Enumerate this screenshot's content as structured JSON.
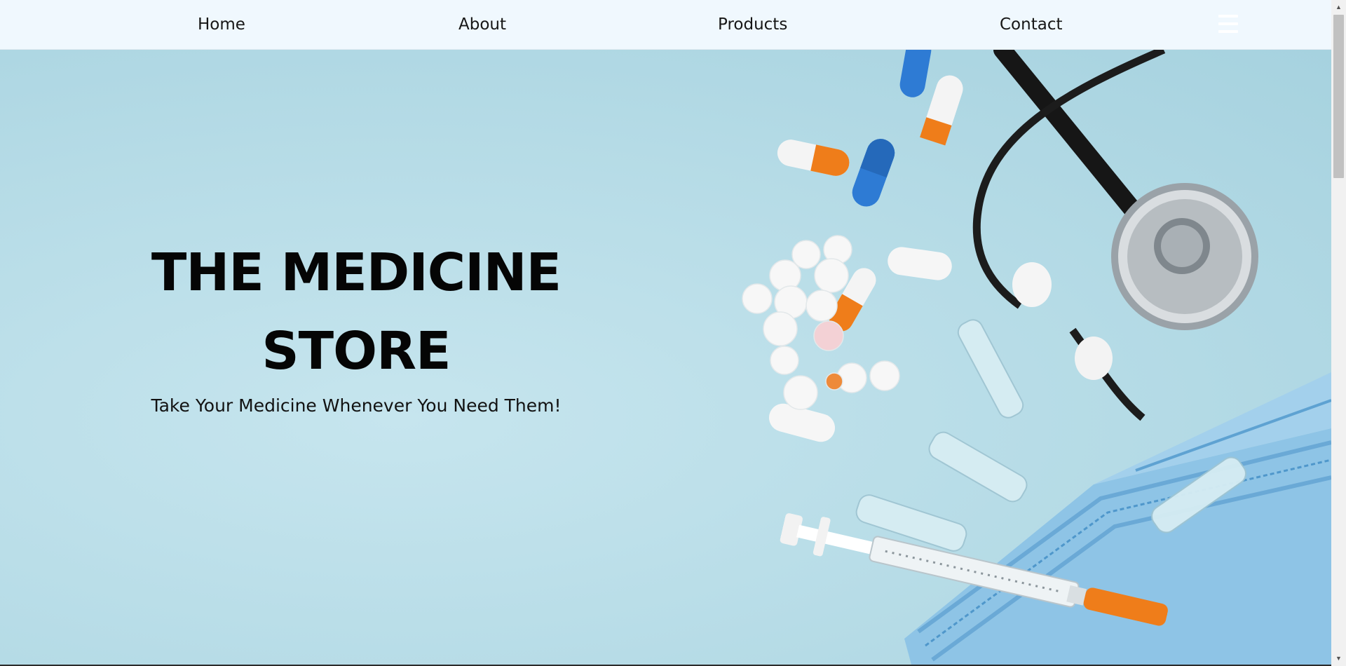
{
  "nav": {
    "links": [
      {
        "label": "Home"
      },
      {
        "label": "About"
      },
      {
        "label": "Products"
      },
      {
        "label": "Contact"
      }
    ],
    "menu_icon": "hamburger-menu-icon"
  },
  "hero": {
    "title_line1": "THE MEDICINE",
    "title_line2": "STORE",
    "subtitle": "Take Your Medicine Whenever You Need Them!",
    "image_subject": "pills, capsules, stethoscope, syringe, ampoules and surgical mask on light blue background"
  },
  "colors": {
    "navbar_bg": "#f0f8fe",
    "hero_bg": "#b5dbe6",
    "title": "#050505",
    "capsule_orange": "#ef7d1a",
    "capsule_blue": "#2e7bd4"
  },
  "scrollbar": {
    "up_icon": "scroll-up-arrow-icon",
    "down_icon": "scroll-down-arrow-icon"
  }
}
